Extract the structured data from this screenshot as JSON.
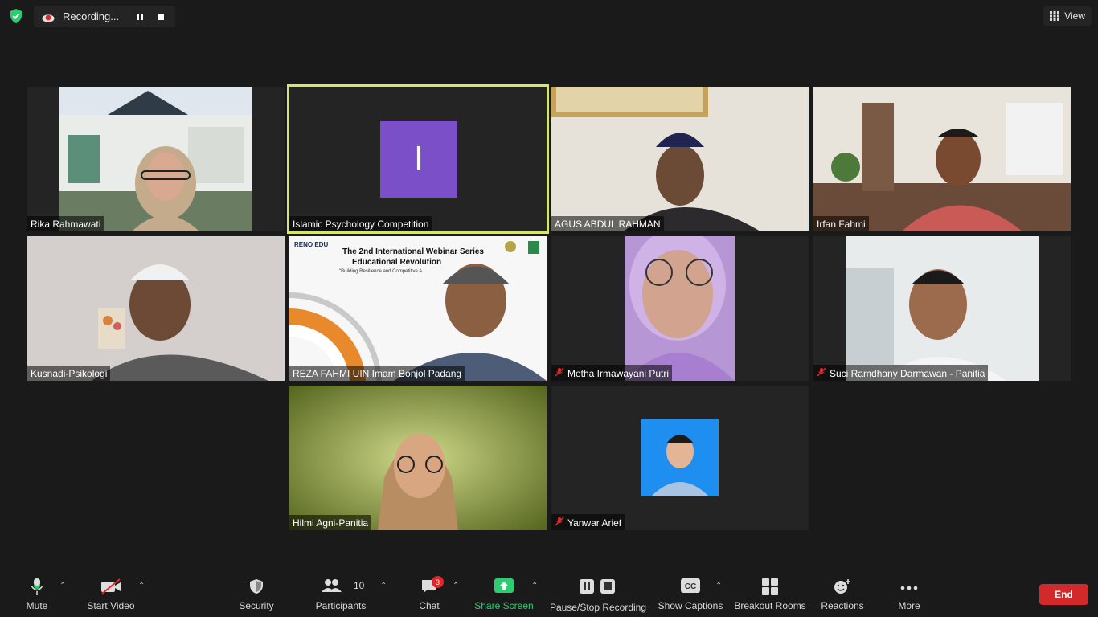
{
  "topbar": {
    "recording_label": "Recording...",
    "view_label": "View"
  },
  "participants_grid": [
    {
      "name": "Rika Rahmawati",
      "muted": false,
      "video": true
    },
    {
      "name": "Islamic Psychology Competition",
      "muted": false,
      "video": false,
      "avatar_letter": "I",
      "active_speaker": true
    },
    {
      "name": "AGUS ABDUL RAHMAN",
      "muted": false,
      "video": true
    },
    {
      "name": "Irfan Fahmi",
      "muted": false,
      "video": true
    },
    {
      "name": "Kusnadi-Psikologi",
      "muted": false,
      "video": true
    },
    {
      "name": "REZA FAHMI UIN Imam Bonjol Padang",
      "muted": false,
      "video": true
    },
    {
      "name": "Metha Irmawayani Putri",
      "muted": true,
      "video": true
    },
    {
      "name": "Suci Ramdhany Darmawan - Panitia",
      "muted": true,
      "video": true
    },
    {
      "name": "Hilmi Agni-Panitia",
      "muted": false,
      "video": true
    },
    {
      "name": "Yanwar Arief",
      "muted": true,
      "video": false
    }
  ],
  "webinar_slide": {
    "brand": "RENO EDU",
    "title_line1": "The 2nd International Webinar Series",
    "title_line2": "Educational Revolution",
    "tagline": "\"Building Resilience and Competitive A"
  },
  "toolbar": {
    "mute": "Mute",
    "start_video": "Start Video",
    "security": "Security",
    "participants": "Participants",
    "participants_count": "10",
    "chat": "Chat",
    "chat_badge": "3",
    "share_screen": "Share Screen",
    "pause_stop_recording": "Pause/Stop Recording",
    "show_captions": "Show Captions",
    "breakout_rooms": "Breakout Rooms",
    "reactions": "Reactions",
    "more": "More",
    "end": "End"
  },
  "colors": {
    "active_speaker_border": "#d6e66b",
    "avatar_purple": "#7b4fc8",
    "share_green": "#2ecc71",
    "end_red": "#d22a2a",
    "shield_green": "#2ecc71"
  }
}
